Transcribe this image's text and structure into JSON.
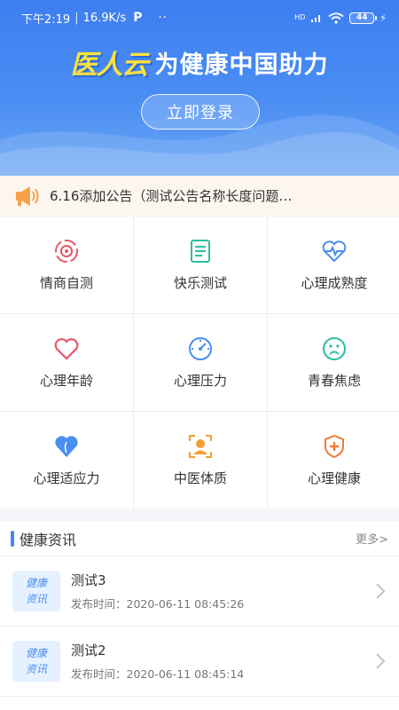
{
  "status_bar": {
    "time": "下午2:19",
    "speed": "16.9K/s",
    "p_icon": "P",
    "dots": "··",
    "hd": "HD",
    "battery": "44"
  },
  "header": {
    "logo": "医人云",
    "slogan": "为健康中国助力",
    "login_label": "立即登录",
    "colors": {
      "bg_top": "#3d7ef0",
      "logo_yellow": "#ffe13d"
    }
  },
  "notice": {
    "icon": "megaphone-icon",
    "text": "6.16添加公告（测试公告名称长度问题…"
  },
  "grid": {
    "items": [
      {
        "label": "情商自测",
        "icon": "target-icon",
        "color": "#e8546a"
      },
      {
        "label": "快乐测试",
        "icon": "document-icon",
        "color": "#2bbfa0"
      },
      {
        "label": "心理成熟度",
        "icon": "heart-pulse-icon",
        "color": "#4a8ef0"
      },
      {
        "label": "心理年龄",
        "icon": "heart-outline-icon",
        "color": "#e8546a"
      },
      {
        "label": "心理压力",
        "icon": "gauge-icon",
        "color": "#4a8ef0"
      },
      {
        "label": "青春焦虑",
        "icon": "sad-face-icon",
        "color": "#2bbfa0"
      },
      {
        "label": "心理适应力",
        "icon": "heart-solid-icon",
        "color": "#4a8ef0"
      },
      {
        "label": "中医体质",
        "icon": "doctor-scan-icon",
        "color": "#f0a030"
      },
      {
        "label": "心理健康",
        "icon": "shield-plus-icon",
        "color": "#f07a30"
      }
    ]
  },
  "news": {
    "title": "健康资讯",
    "more": "更多>",
    "thumb_line1": "健康",
    "thumb_line2": "资讯",
    "items": [
      {
        "title": "测试3",
        "time": "发布时间：2020-06-11 08:45:26"
      },
      {
        "title": "测试2",
        "time": "发布时间：2020-06-11 08:45:14"
      }
    ]
  }
}
